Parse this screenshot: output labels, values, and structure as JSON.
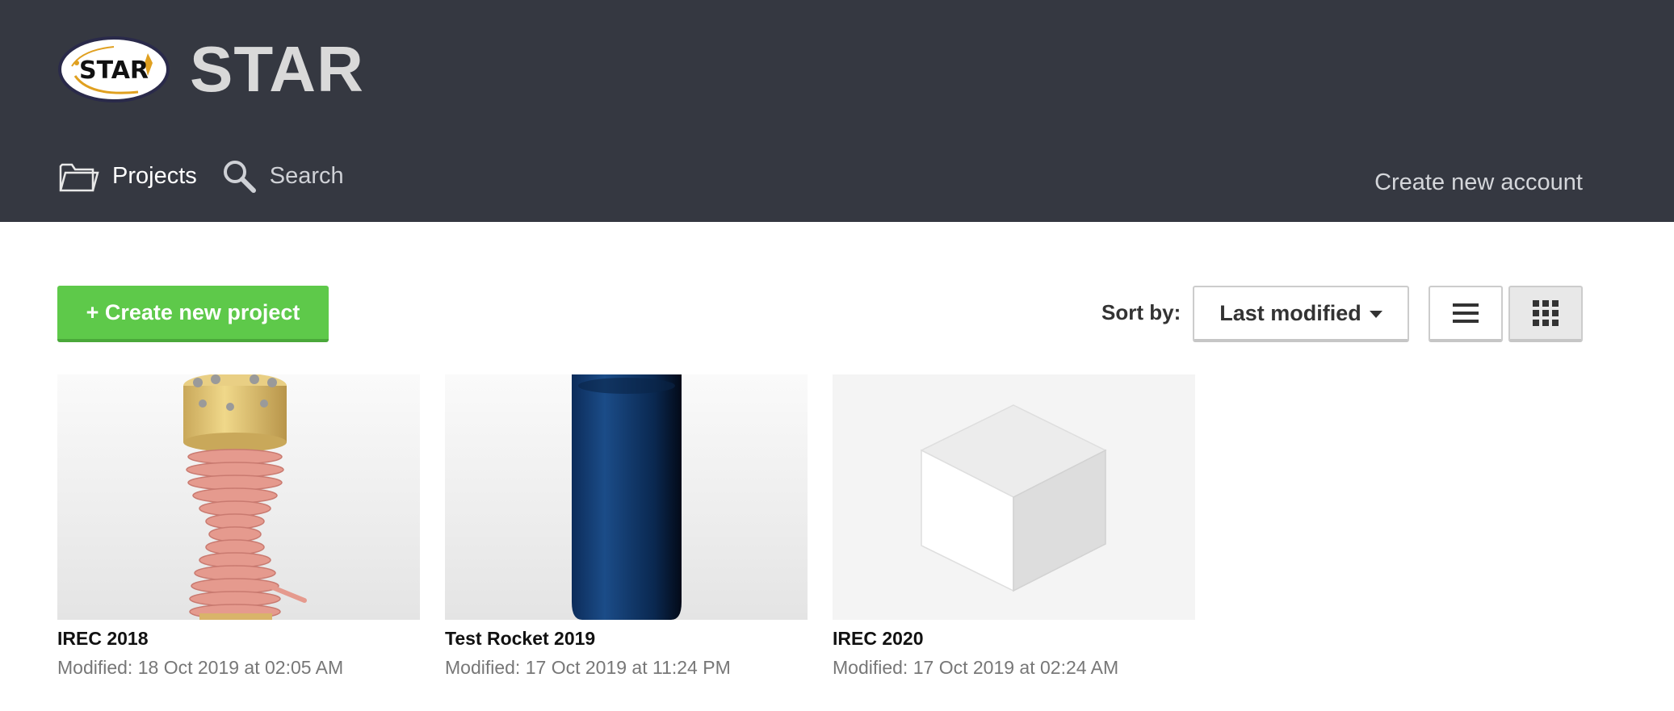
{
  "app": {
    "logo_text": "STAR",
    "name": "STAR"
  },
  "nav": {
    "projects_label": "Projects",
    "search_label": "Search",
    "create_account_label": "Create new account"
  },
  "toolbar": {
    "create_project_label": "+ Create new project",
    "sort_label": "Sort by:",
    "sort_value": "Last modified"
  },
  "projects": [
    {
      "title": "IREC 2018",
      "modified": "Modified: 18 Oct 2019 at 02:05 AM"
    },
    {
      "title": "Test Rocket 2019",
      "modified": "Modified: 17 Oct 2019 at 11:24 PM"
    },
    {
      "title": "IREC 2020",
      "modified": "Modified: 17 Oct 2019 at 02:24 AM"
    }
  ],
  "colors": {
    "header_bg": "#353841",
    "create_button": "#5ec94a",
    "page_bg": "#ffffff"
  },
  "icons": {
    "projects": "folder-icon",
    "search": "search-icon",
    "list_view": "list-view-icon",
    "grid_view": "grid-view-icon"
  }
}
